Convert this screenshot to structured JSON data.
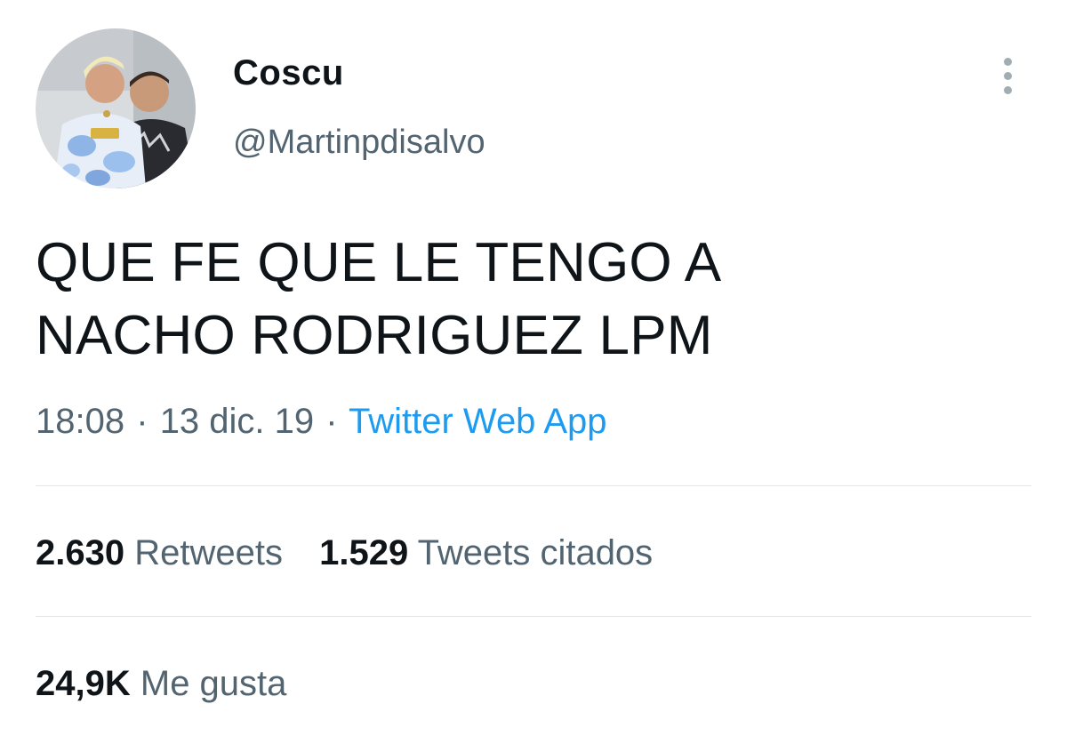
{
  "colors": {
    "text_primary": "#0f1419",
    "text_secondary": "#536471",
    "link": "#1d9bf0",
    "divider": "#e3e7ea"
  },
  "author": {
    "display_name": "Coscu",
    "handle": "@Martinpdisalvo"
  },
  "tweet": {
    "lines": [
      "QUE FE QUE LE TENGO A",
      "NACHO RODRIGUEZ LPM"
    ],
    "time": "18:08",
    "separator": "·",
    "date": "13 dic. 19",
    "source": "Twitter Web App"
  },
  "stats": {
    "retweets": {
      "count": "2.630",
      "label": "Retweets"
    },
    "quotes": {
      "count": "1.529",
      "label": "Tweets citados"
    },
    "likes": {
      "count": "24,9K",
      "label": "Me gusta"
    }
  },
  "icons": {
    "more": "more-options-icon"
  }
}
